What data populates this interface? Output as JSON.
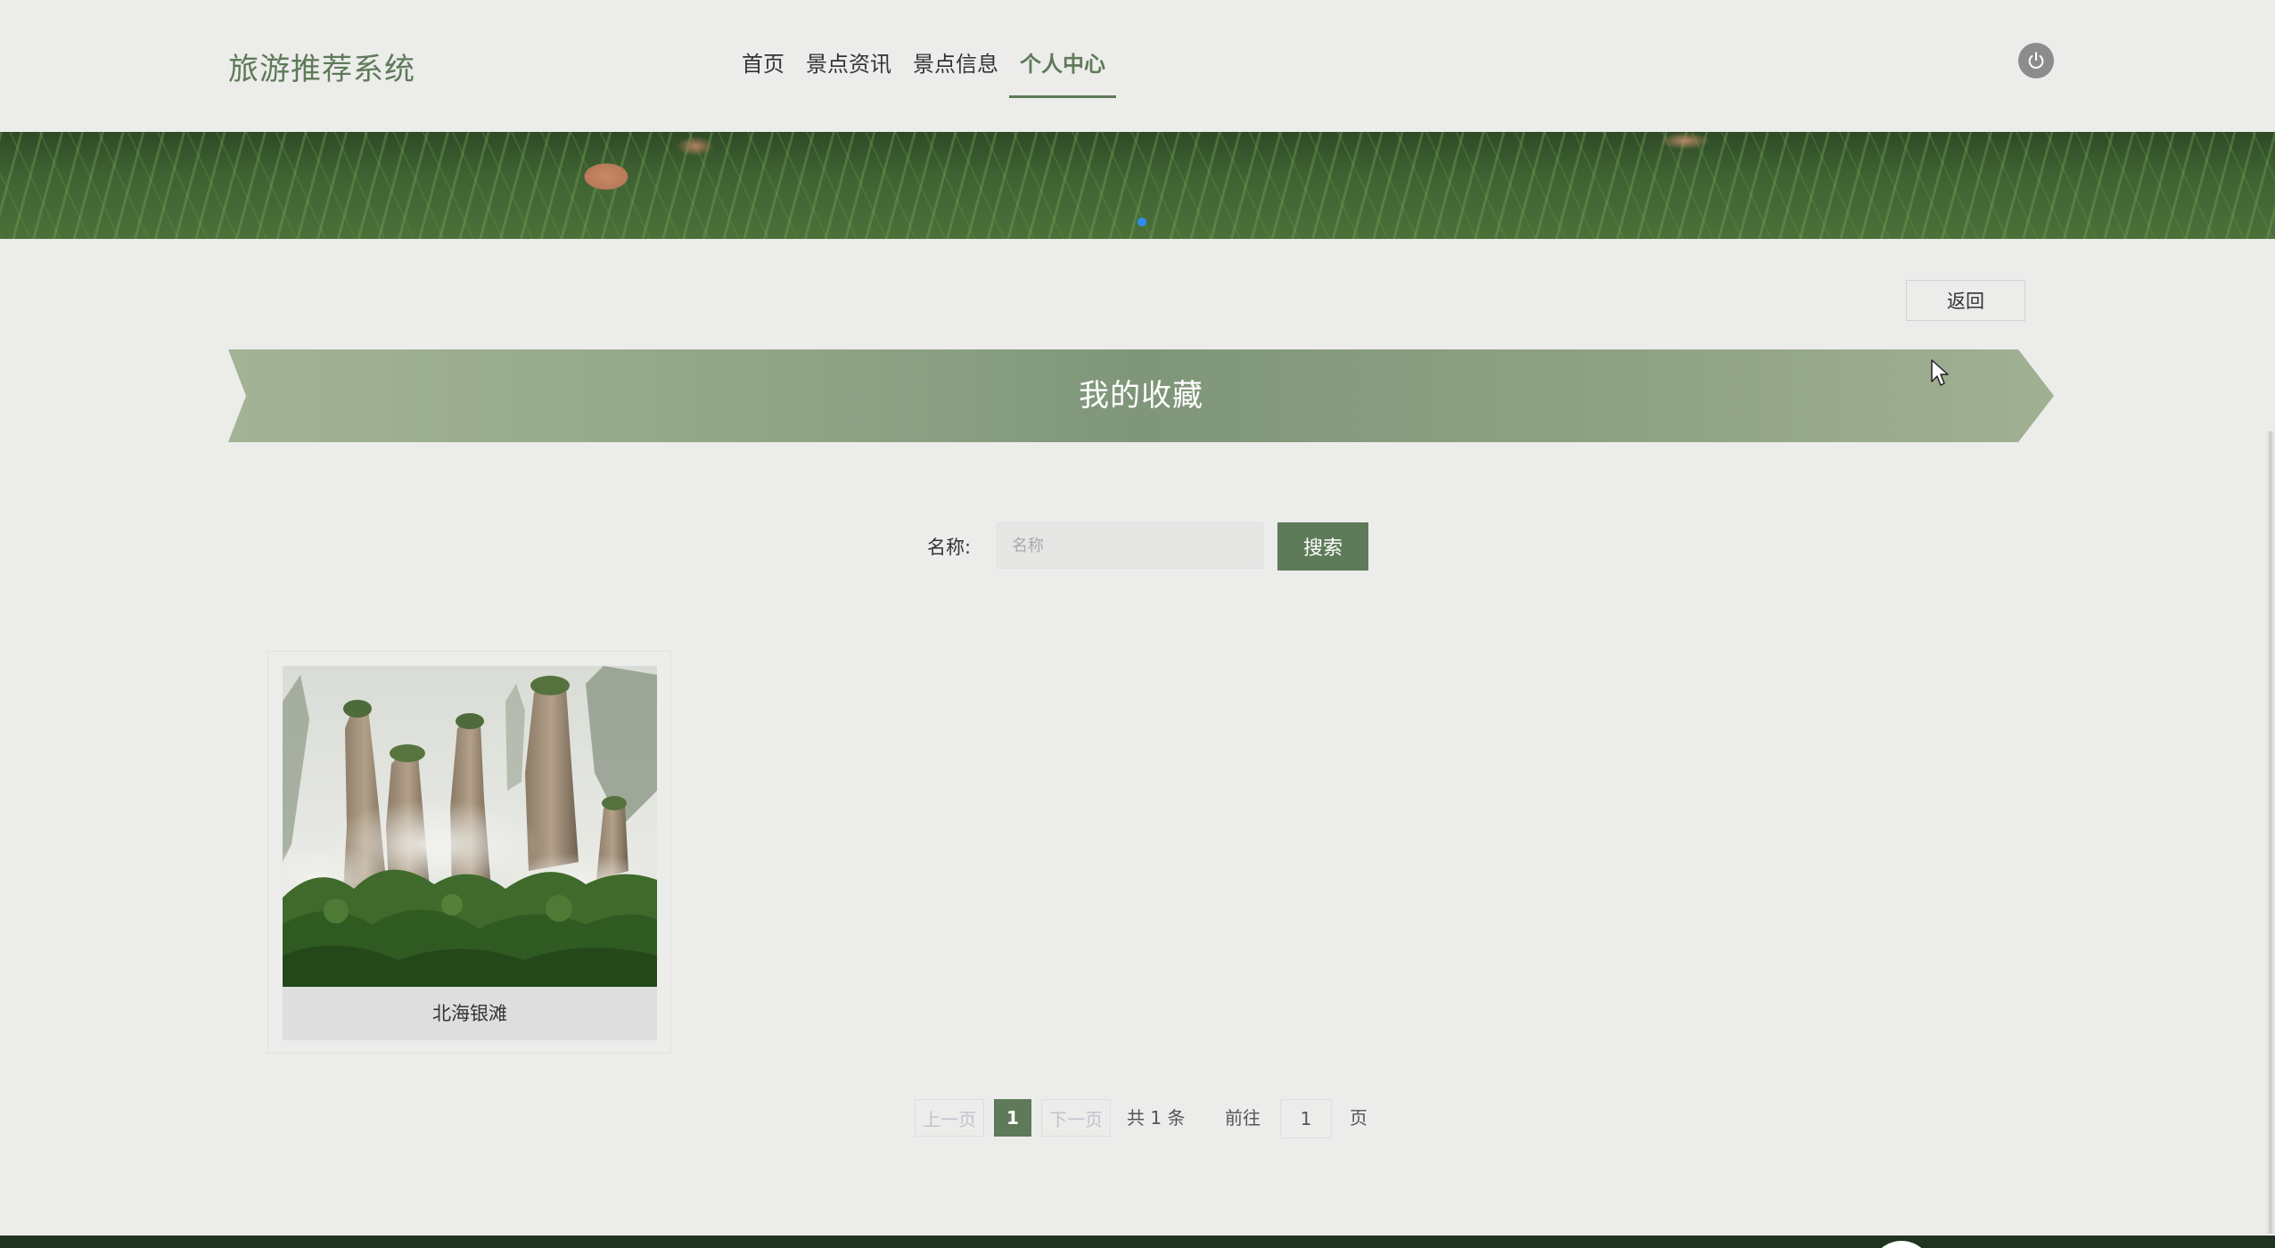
{
  "header": {
    "brand": "旅游推荐系统",
    "nav": [
      {
        "label": "首页",
        "active": false
      },
      {
        "label": "景点资讯",
        "active": false
      },
      {
        "label": "景点信息",
        "active": false
      },
      {
        "label": "个人中心",
        "active": true
      }
    ],
    "power_icon": "power-icon"
  },
  "banner": {
    "indicator_color": "#2d8cf0"
  },
  "back_button": {
    "label": "返回"
  },
  "section": {
    "title": "我的收藏"
  },
  "search": {
    "label": "名称:",
    "placeholder": "名称",
    "value": "",
    "button_label": "搜索"
  },
  "favorites": [
    {
      "name": "北海银滩"
    }
  ],
  "pagination": {
    "prev_label": "上一页",
    "current_page": "1",
    "next_label": "下一页",
    "total_text": "共 1 条",
    "goto_label": "前往",
    "goto_value": "1",
    "page_suffix": "页"
  },
  "colors": {
    "accent": "#5e7a58",
    "background": "#ececeb",
    "footer": "#1f3320"
  }
}
